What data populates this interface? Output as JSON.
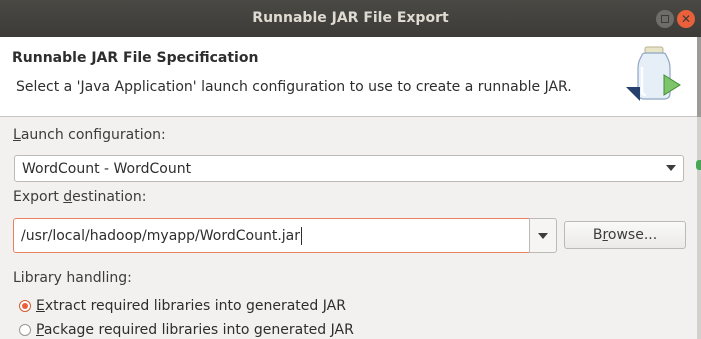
{
  "window": {
    "title": "Runnable JAR File Export"
  },
  "header": {
    "title": "Runnable JAR File Specification",
    "description": "Select a 'Java Application' launch configuration to use to create a runnable JAR.",
    "icon": "jar-export-wizard-icon"
  },
  "launch": {
    "label_u": "L",
    "label_rest": "aunch configuration:",
    "value": "WordCount - WordCount"
  },
  "export": {
    "label_pre": "Export ",
    "label_u": "d",
    "label_rest": "estination:",
    "value": "/usr/local/hadoop/myapp/WordCount.jar"
  },
  "browse": {
    "label_pre": "B",
    "label_u": "r",
    "label_rest": "owse..."
  },
  "library": {
    "label": "Library handling:",
    "options": [
      {
        "u": "E",
        "rest": "xtract required libraries into generated JAR",
        "selected": true
      },
      {
        "u": "P",
        "rest": "ackage required libraries into generated JAR",
        "selected": false
      }
    ]
  },
  "colors": {
    "accent": "#e9603a",
    "titlebar": "#3c3b37"
  }
}
